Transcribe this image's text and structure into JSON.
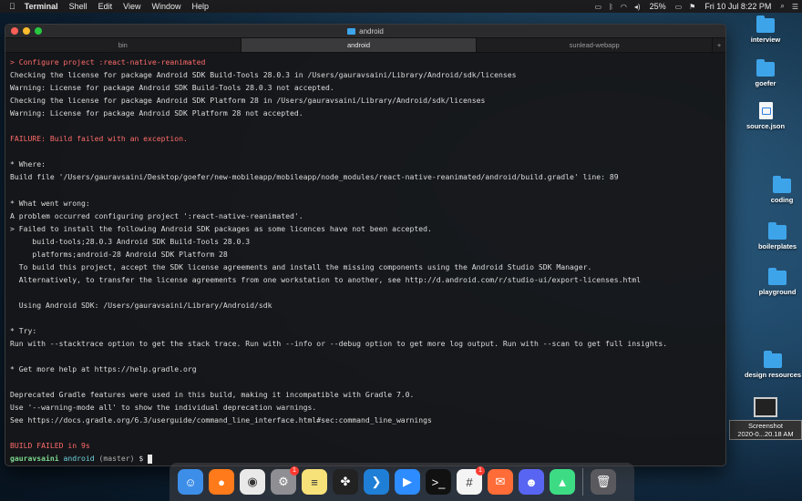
{
  "menubar": {
    "app": "Terminal",
    "menus": [
      "Shell",
      "Edit",
      "View",
      "Window",
      "Help"
    ],
    "battery": "25%",
    "datetime": "Fri 10 Jul  8:22 PM"
  },
  "desktop": {
    "icons": [
      {
        "label": "interview",
        "type": "folder"
      },
      {
        "label": "goefer",
        "type": "folder"
      },
      {
        "label": "source.json",
        "type": "doc"
      },
      {
        "label": "coding",
        "type": "folder"
      },
      {
        "label": "boilerplates",
        "type": "folder"
      },
      {
        "label": "playground",
        "type": "folder"
      },
      {
        "label": "design resources",
        "type": "folder"
      }
    ],
    "screenshot": {
      "label1": "Screenshot",
      "label2": "2020-0...20.18 AM"
    }
  },
  "window": {
    "title": "android",
    "tabs": [
      {
        "label": "bin",
        "active": false
      },
      {
        "label": "android",
        "active": true
      },
      {
        "label": "sunlead-webapp",
        "active": false
      }
    ],
    "add_tab": "+"
  },
  "terminal": {
    "lines": [
      {
        "text": "> Configure project :react-native-reanimated",
        "style": "red"
      },
      {
        "text": "Checking the license for package Android SDK Build-Tools 28.0.3 in /Users/gauravsaini/Library/Android/sdk/licenses",
        "style": ""
      },
      {
        "text": "Warning: License for package Android SDK Build-Tools 28.0.3 not accepted.",
        "style": ""
      },
      {
        "text": "Checking the license for package Android SDK Platform 28 in /Users/gauravsaini/Library/Android/sdk/licenses",
        "style": ""
      },
      {
        "text": "Warning: License for package Android SDK Platform 28 not accepted.",
        "style": ""
      },
      {
        "text": "",
        "style": ""
      },
      {
        "text": "FAILURE: Build failed with an exception.",
        "style": "red"
      },
      {
        "text": "",
        "style": ""
      },
      {
        "text": "* Where:",
        "style": ""
      },
      {
        "text": "Build file '/Users/gauravsaini/Desktop/goefer/new-mobileapp/mobileapp/node_modules/react-native-reanimated/android/build.gradle' line: 89",
        "style": ""
      },
      {
        "text": "",
        "style": ""
      },
      {
        "text": "* What went wrong:",
        "style": ""
      },
      {
        "text": "A problem occurred configuring project ':react-native-reanimated'.",
        "style": ""
      },
      {
        "text": "> Failed to install the following Android SDK packages as some licences have not been accepted.",
        "style": ""
      },
      {
        "text": "     build-tools;28.0.3 Android SDK Build-Tools 28.0.3",
        "style": ""
      },
      {
        "text": "     platforms;android-28 Android SDK Platform 28",
        "style": ""
      },
      {
        "text": "  To build this project, accept the SDK license agreements and install the missing components using the Android Studio SDK Manager.",
        "style": ""
      },
      {
        "text": "  Alternatively, to transfer the license agreements from one workstation to another, see http://d.android.com/r/studio-ui/export-licenses.html",
        "style": ""
      },
      {
        "text": "",
        "style": ""
      },
      {
        "text": "  Using Android SDK: /Users/gauravsaini/Library/Android/sdk",
        "style": ""
      },
      {
        "text": "",
        "style": ""
      },
      {
        "text": "* Try:",
        "style": ""
      },
      {
        "text": "Run with --stacktrace option to get the stack trace. Run with --info or --debug option to get more log output. Run with --scan to get full insights.",
        "style": ""
      },
      {
        "text": "",
        "style": ""
      },
      {
        "text": "* Get more help at https://help.gradle.org",
        "style": ""
      },
      {
        "text": "",
        "style": ""
      },
      {
        "text": "Deprecated Gradle features were used in this build, making it incompatible with Gradle 7.0.",
        "style": ""
      },
      {
        "text": "Use '--warning-mode all' to show the individual deprecation warnings.",
        "style": ""
      },
      {
        "text": "See https://docs.gradle.org/6.3/userguide/command_line_interface.html#sec:command_line_warnings",
        "style": ""
      },
      {
        "text": "",
        "style": ""
      },
      {
        "text": "BUILD FAILED in 9s",
        "style": "red"
      }
    ],
    "prompt": {
      "user": "gauravsaini",
      "dir": "android",
      "branch": "(master)",
      "symbol": "$"
    }
  },
  "dock": {
    "apps": [
      {
        "name": "finder-icon",
        "glyph": "☺",
        "bg": "#3d8ee8"
      },
      {
        "name": "firefox-icon",
        "glyph": "●",
        "bg": "#ff7a1a"
      },
      {
        "name": "chrome-icon",
        "glyph": "◉",
        "bg": "#e9e9e9"
      },
      {
        "name": "system-preferences-icon",
        "glyph": "⚙",
        "bg": "#8e8e93",
        "badge": "1"
      },
      {
        "name": "notes-icon",
        "glyph": "≡",
        "bg": "#f7e27a"
      },
      {
        "name": "figma-icon",
        "glyph": "✤",
        "bg": "#222222"
      },
      {
        "name": "vscode-icon",
        "glyph": "❯",
        "bg": "#1f7fd6"
      },
      {
        "name": "zoom-icon",
        "glyph": "▶",
        "bg": "#2d8cff"
      },
      {
        "name": "terminal-icon",
        "glyph": ">_",
        "bg": "#111111"
      },
      {
        "name": "slack-icon",
        "glyph": "#",
        "bg": "#f4f4f4",
        "badge": "1"
      },
      {
        "name": "postman-icon",
        "glyph": "✉",
        "bg": "#ff6c37"
      },
      {
        "name": "discord-icon",
        "glyph": "☻",
        "bg": "#5865f2"
      },
      {
        "name": "android-studio-icon",
        "glyph": "▲",
        "bg": "#3ddc84"
      }
    ],
    "trash": {
      "name": "trash-icon",
      "glyph": "🗑",
      "bg": "#5a5a5e"
    }
  }
}
